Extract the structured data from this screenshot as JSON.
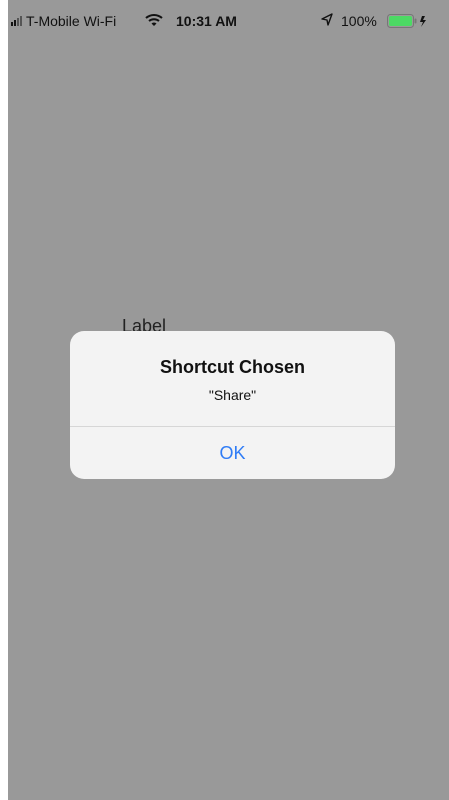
{
  "status_bar": {
    "carrier": "T-Mobile Wi-Fi",
    "time": "10:31 AM",
    "battery": "100%",
    "icons": [
      "signal-icon",
      "wifi-icon",
      "location-icon",
      "battery-icon"
    ]
  },
  "screen": {
    "label": "Label"
  },
  "alert": {
    "title": "Shortcut Chosen",
    "message": "\"Share\"",
    "ok_label": "OK"
  },
  "colors": {
    "dimmed_background": "#999999",
    "alert_background": "#f3f3f3",
    "button_text": "#2f7cf6",
    "battery": "#4cd964"
  }
}
